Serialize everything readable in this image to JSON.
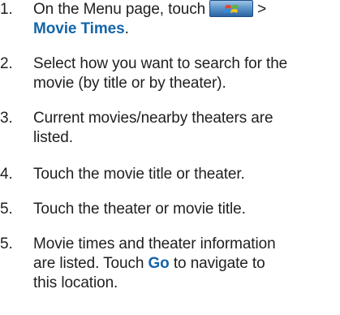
{
  "steps": [
    {
      "number": "1.",
      "text_before": "On the Menu page, touch",
      "icon": "windows-flag-menu-icon",
      "text_after": ">",
      "highlight": "Movie Times",
      "text_end": "."
    },
    {
      "number": "2.",
      "line1": "Select how you want to search for the",
      "line2": "movie (by title or by theater)."
    },
    {
      "number": "3.",
      "line1": "Current movies/nearby theaters are",
      "line2": "listed."
    },
    {
      "number": "4.",
      "line1": "Touch the movie title or theater."
    },
    {
      "number": "5.",
      "line1": "Touch the theater or movie title."
    },
    {
      "number": "5.",
      "line1": "Movie times and theater information",
      "line2_before": "are listed. Touch",
      "highlight": "Go",
      "line2_after": "to navigate to",
      "line3": "this location."
    }
  ]
}
